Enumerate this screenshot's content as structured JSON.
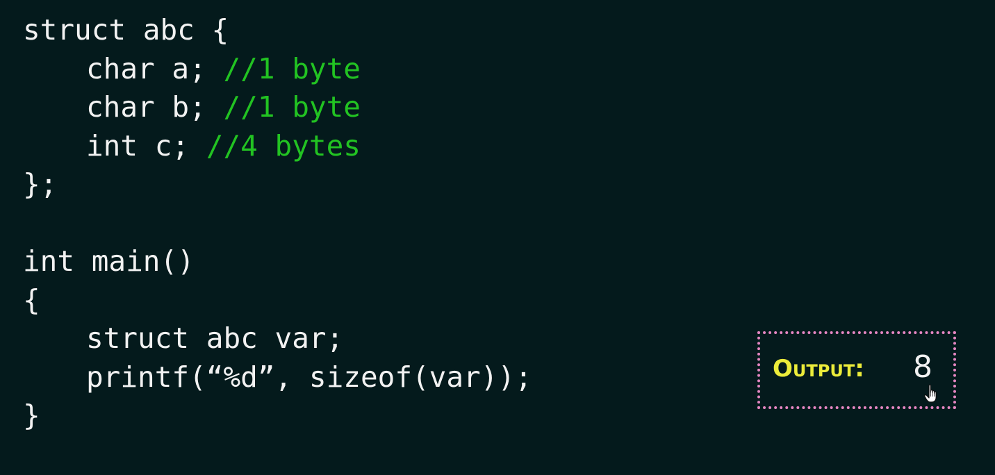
{
  "code": {
    "lines": [
      {
        "code": "struct abc {",
        "comment": ""
      },
      {
        "code": "char a; ",
        "comment": "//1 byte"
      },
      {
        "code": "char b; ",
        "comment": "//1 byte"
      },
      {
        "code": "int c; ",
        "comment": "//4 bytes"
      },
      {
        "code": "};",
        "comment": ""
      },
      {
        "code": "",
        "comment": ""
      },
      {
        "code": "int main()",
        "comment": ""
      },
      {
        "code": "{",
        "comment": ""
      },
      {
        "code": "struct abc var;",
        "comment": ""
      },
      {
        "code": "printf(“%d”, sizeof(var));",
        "comment": ""
      },
      {
        "code": "}",
        "comment": ""
      }
    ]
  },
  "output": {
    "label": "Output:",
    "value": "8"
  },
  "colors": {
    "background": "#041a1c",
    "code_text": "#f2f2f2",
    "comment": "#22c322",
    "output_label": "#ecec3a",
    "output_border": "#e586c2"
  },
  "icons": {
    "cursor": "hand-pointer-icon"
  }
}
